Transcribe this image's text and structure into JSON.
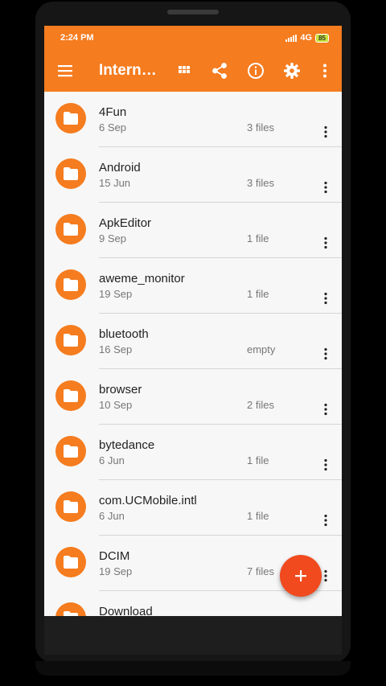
{
  "status_bar": {
    "time": "2:24 PM",
    "network": "4G",
    "battery": "85"
  },
  "app_bar": {
    "title": "Internal storage",
    "actions": [
      "grid-view-icon",
      "share-icon",
      "info-icon",
      "settings-icon",
      "more-vert-icon"
    ]
  },
  "colors": {
    "accent": "#F57C1F",
    "fab": "#F04A1E"
  },
  "files": [
    {
      "name": "4Fun",
      "date": "6 Sep",
      "count": "3 files"
    },
    {
      "name": "Android",
      "date": "15 Jun",
      "count": "3 files"
    },
    {
      "name": "ApkEditor",
      "date": "9 Sep",
      "count": "1 file"
    },
    {
      "name": "aweme_monitor",
      "date": "19 Sep",
      "count": "1 file"
    },
    {
      "name": "bluetooth",
      "date": "16 Sep",
      "count": "empty"
    },
    {
      "name": "browser",
      "date": "10 Sep",
      "count": "2 files"
    },
    {
      "name": "bytedance",
      "date": "6 Jun",
      "count": "1 file"
    },
    {
      "name": "com.UCMobile.intl",
      "date": "6 Jun",
      "count": "1 file"
    },
    {
      "name": "DCIM",
      "date": "19 Sep",
      "count": "7 files"
    },
    {
      "name": "Download",
      "date": "",
      "count": ""
    }
  ],
  "fab": {
    "icon": "plus-icon"
  }
}
